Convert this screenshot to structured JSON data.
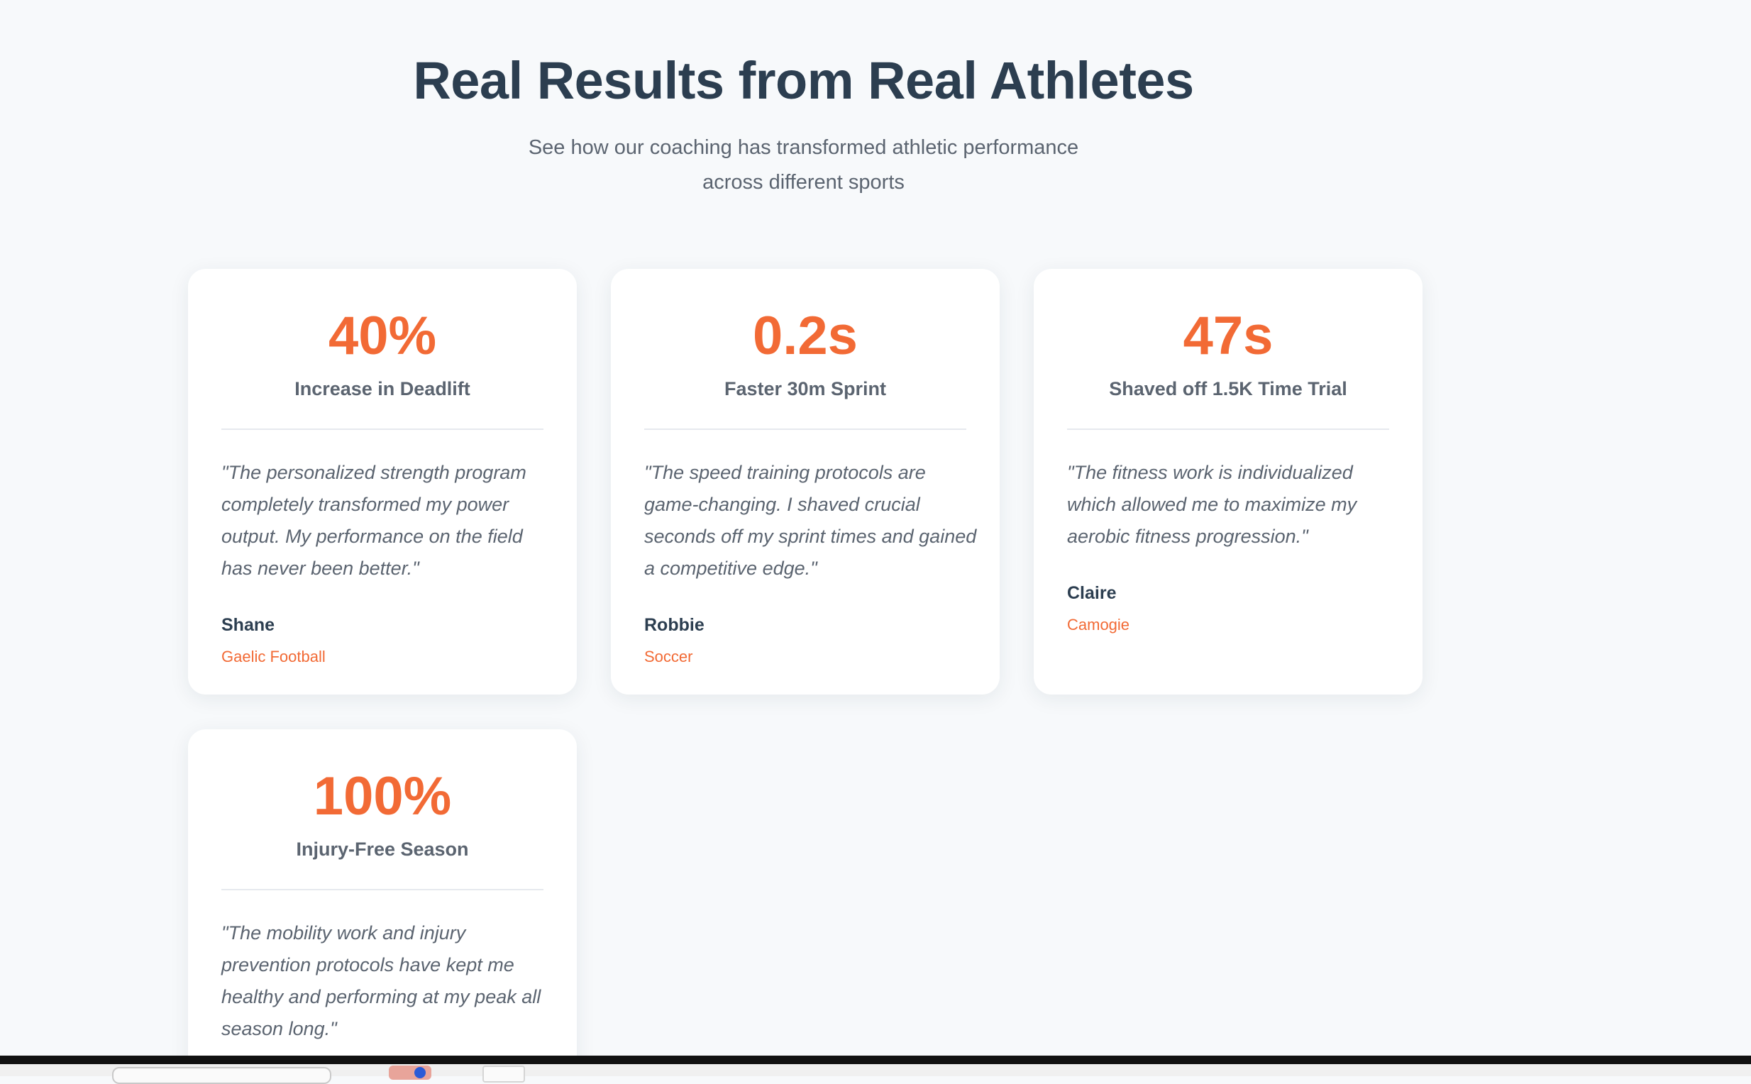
{
  "header": {
    "title": "Real Results from Real Athletes",
    "subtitle_line_1": "See how our coaching has transformed athletic performance",
    "subtitle_line_2": "across different sports"
  },
  "testimonials": [
    {
      "metric": "40%",
      "metric_label": "Increase in Deadlift",
      "quote": "\"The personalized strength program completely transformed my power output. My performance on the field has never been better.\"",
      "name": "Shane",
      "sport": "Gaelic Football"
    },
    {
      "metric": "0.2s",
      "metric_label": "Faster 30m Sprint",
      "quote": "\"The speed training protocols are game-changing. I shaved crucial seconds off my sprint times and gained a competitive edge.\"",
      "name": "Robbie",
      "sport": "Soccer"
    },
    {
      "metric": "47s",
      "metric_label": "Shaved off 1.5K Time Trial",
      "quote": "\"The fitness work is individualized which allowed me to maximize my aerobic fitness progression.\"",
      "name": "Claire",
      "sport": "Camogie"
    },
    {
      "metric": "100%",
      "metric_label": "Injury-Free Season",
      "quote": "\"The mobility work and injury prevention protocols have kept me healthy and performing at my peak all season long.\""
    }
  ],
  "colors": {
    "accent": "#f26a35",
    "heading": "#2c3e50",
    "body_text": "#5b6470",
    "background": "#f7f9fb",
    "card": "#ffffff"
  }
}
